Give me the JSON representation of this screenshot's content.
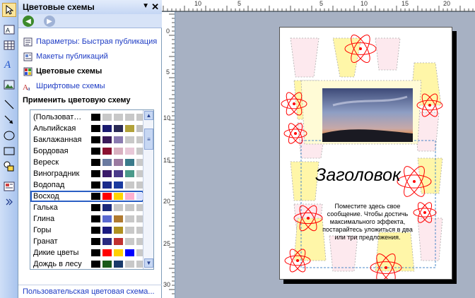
{
  "pane": {
    "title": "Цветовые схемы",
    "links": [
      {
        "label": "Параметры: Быстрая публикация",
        "icon": "publication-options-icon"
      },
      {
        "label": "Макеты публикаций",
        "icon": "layouts-icon"
      },
      {
        "label": "Цветовые схемы",
        "icon": "color-schemes-icon"
      },
      {
        "label": "Шрифтовые схемы",
        "icon": "font-schemes-icon"
      }
    ],
    "apply_label": "Применить цветовую схему",
    "schemes": [
      {
        "name": "(Пользоват…",
        "colors": [
          "#000000",
          "#c8c8c8",
          "#c8c8c8",
          "#c8c8c8",
          "#c8c8c8"
        ]
      },
      {
        "name": "Альпийская",
        "colors": [
          "#000000",
          "#1a1a70",
          "#2a2a55",
          "#b2a23a",
          "#c0c0c0"
        ]
      },
      {
        "name": "Баклажанная",
        "colors": [
          "#000000",
          "#3a1a5a",
          "#8a7ab0",
          "#c8c8c8",
          "#c8c8c8"
        ]
      },
      {
        "name": "Бордовая",
        "colors": [
          "#000000",
          "#8a1030",
          "#d8b0c0",
          "#e8c8d8",
          "#c8c8c8"
        ]
      },
      {
        "name": "Вереск",
        "colors": [
          "#000000",
          "#6a7aa0",
          "#9a7aa0",
          "#3a7a8a",
          "#c8c8c8"
        ]
      },
      {
        "name": "Виноградник",
        "colors": [
          "#000000",
          "#3a1a6a",
          "#4a3a8a",
          "#4a9a8a",
          "#c8c8c8"
        ]
      },
      {
        "name": "Водопад",
        "colors": [
          "#000000",
          "#1a2a8a",
          "#1a3aa0",
          "#c8c8c8",
          "#c8c8c8"
        ]
      },
      {
        "name": "Восход",
        "colors": [
          "#000000",
          "#ff0000",
          "#ffd400",
          "#ffb0d0",
          "#d8e0ff"
        ]
      },
      {
        "name": "Галька",
        "colors": [
          "#000000",
          "#1a2a7a",
          "#c8c8c8",
          "#c8c8c8",
          "#c8c8c8"
        ]
      },
      {
        "name": "Глина",
        "colors": [
          "#000000",
          "#5a6ad0",
          "#b07a30",
          "#c8c8c8",
          "#c8c8c8"
        ]
      },
      {
        "name": "Горы",
        "colors": [
          "#000000",
          "#1a1a80",
          "#b09020",
          "#c8c8c8",
          "#c8c8c8"
        ]
      },
      {
        "name": "Гранат",
        "colors": [
          "#000000",
          "#2a2a80",
          "#c03030",
          "#c8c8c8",
          "#c8c8c8"
        ]
      },
      {
        "name": "Дикие цветы",
        "colors": [
          "#000000",
          "#ff0000",
          "#ffd000",
          "#0000ff",
          "#c8c8c8"
        ]
      },
      {
        "name": "Дождь в лесу",
        "colors": [
          "#000000",
          "#1a5a1a",
          "#1a3a6a",
          "#c8c8c8",
          "#c8c8c8"
        ]
      }
    ],
    "selected_scheme": "Восход",
    "footer_link": "Пользовательская цветовая схема..."
  },
  "ruler": {
    "horizontal": [
      "10",
      "5",
      "5",
      "10",
      "15",
      "20"
    ],
    "vertical": [
      "0",
      "5",
      "10",
      "15",
      "20",
      "25",
      "30"
    ]
  },
  "publication": {
    "headline": "Заголовок",
    "body": "Поместите здесь свое сообщение. Чтобы достичь максимального эффекта, постарайтесь уложиться в два или три предложения."
  },
  "colors": {
    "accent_red": "#ff0000",
    "accent_yellow": "#ffd400",
    "selection_blue": "#2b5fc4",
    "pane_header": "#c4d6f4",
    "workspace_gray": "#a7b1c3"
  }
}
